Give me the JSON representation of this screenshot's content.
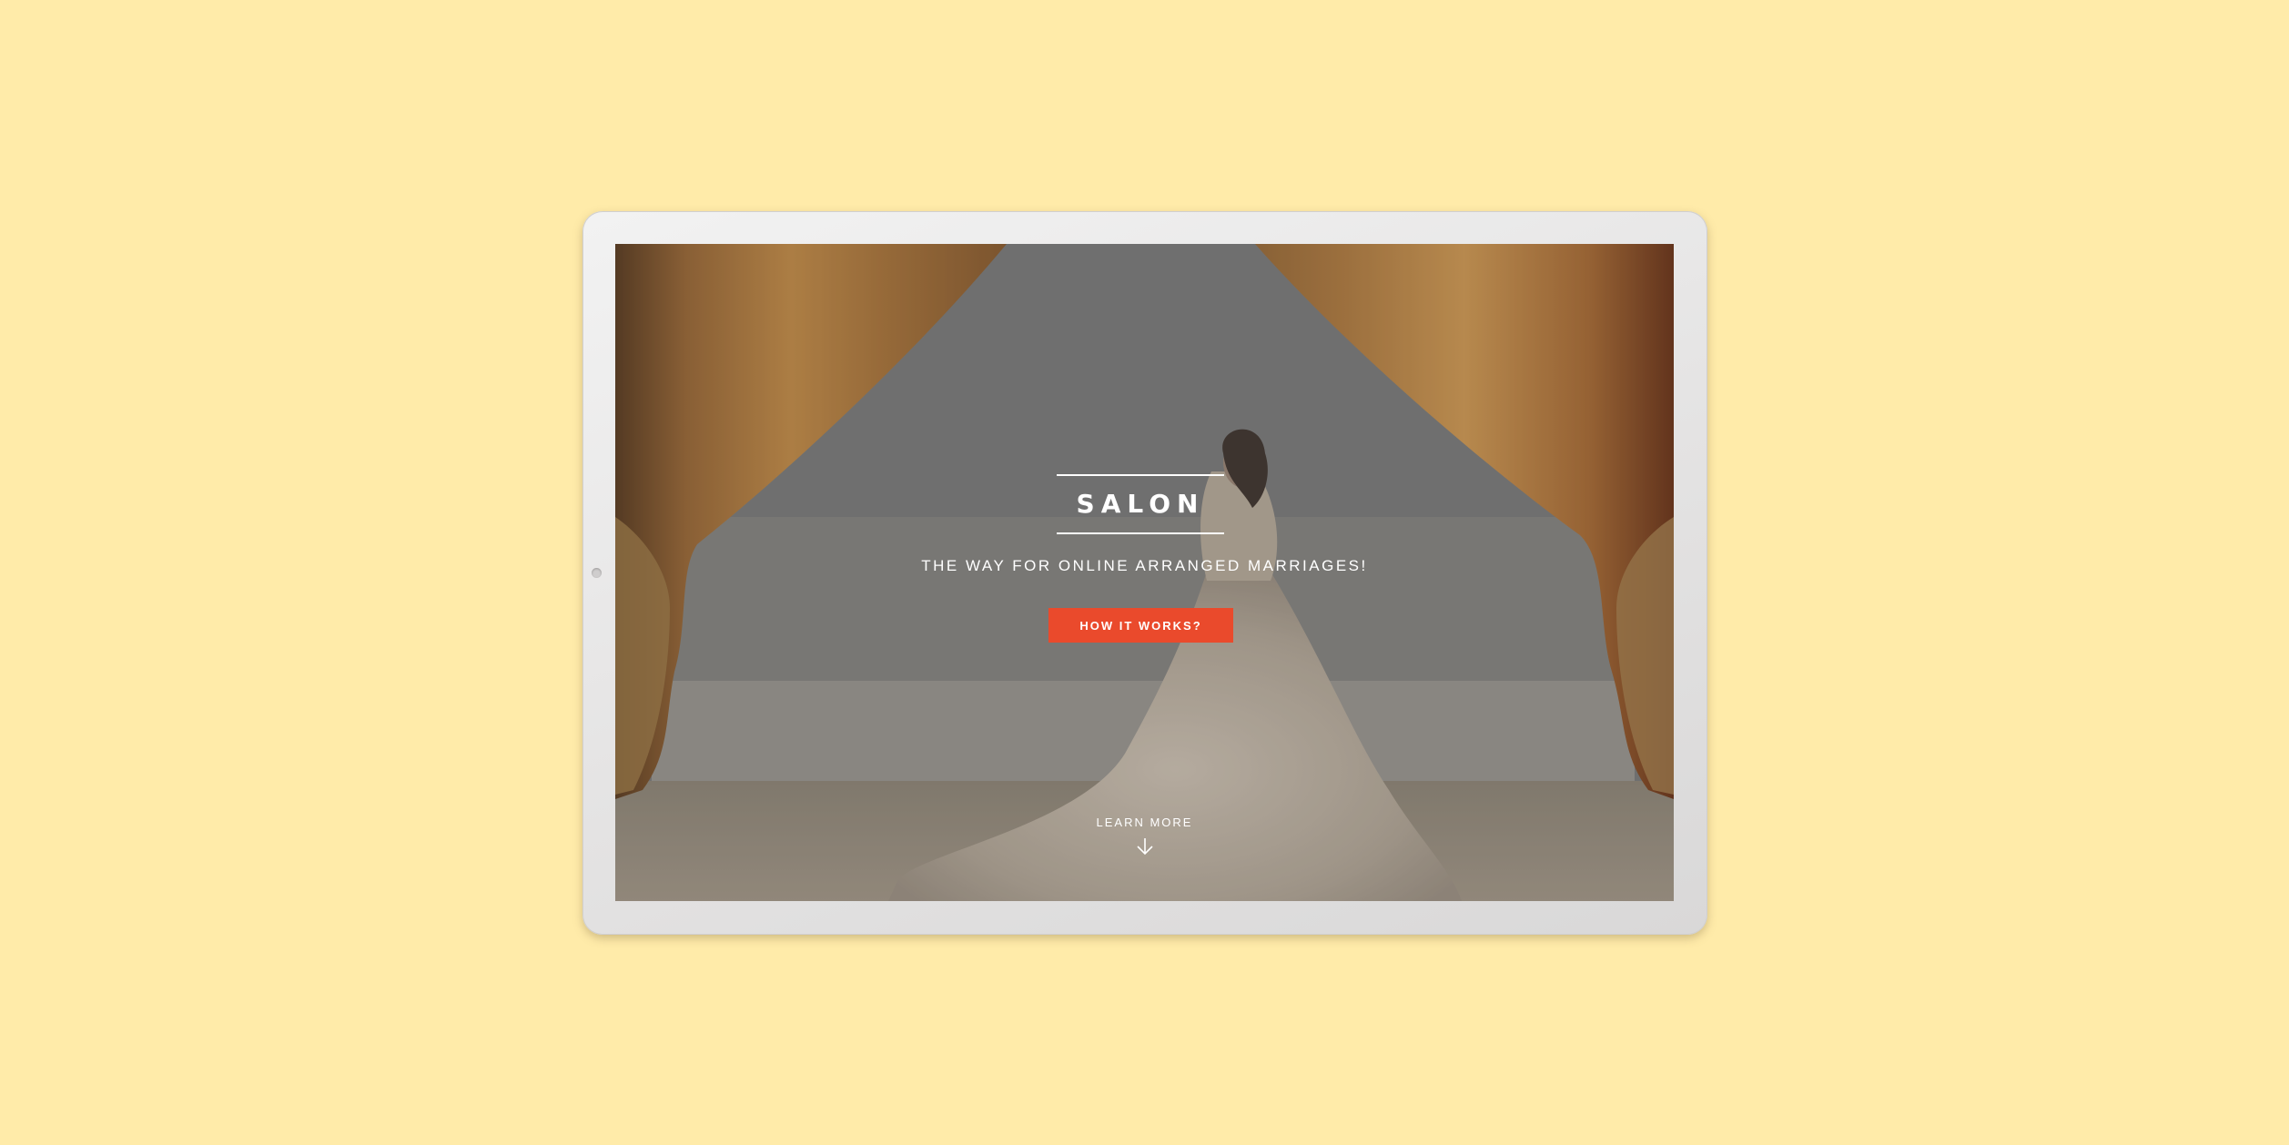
{
  "hero": {
    "brand": "SALON",
    "tagline": "THE WAY FOR ONLINE ARRANGED MARRIAGES!",
    "cta_label": "HOW IT WORKS?",
    "learn_more_label": "LEARN MORE",
    "learn_more_icon": "arrow-down-icon"
  },
  "colors": {
    "page_background": "#ffeba9",
    "cta": "#ea4a2c",
    "text": "#ffffff"
  }
}
